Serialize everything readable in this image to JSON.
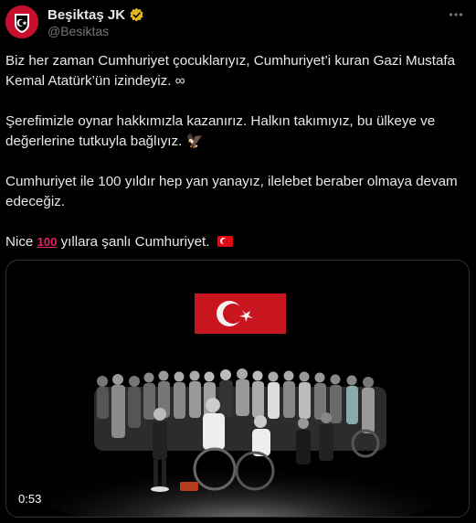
{
  "tweet": {
    "display_name": "Beşiktaş JK",
    "handle": "@Besiktas",
    "paragraphs": {
      "p1": "Biz her zaman Cumhuriyet çocuklarıyız, Cumhuriyet’i kuran Gazi Mustafa Kemal Atatürk’ün izindeyiz. ∞",
      "p2": "Şerefimizle oynar hakkımızla kazanırız. Halkın takımıyız, bu ülkeye ve değerlerine tutkuyla bağlıyız.",
      "p3": "Cumhuriyet ile 100 yıldır hep yan yanayız, ilelebet beraber olmaya devam edeceğiz.",
      "p4_before": "Nice",
      "p4_emoji": "100",
      "p4_after": "yıllara şanlı Cumhuriyet."
    },
    "eagle_emoji": "🦅",
    "flag_emoji": "turkey-flag-icon"
  },
  "media": {
    "type": "video",
    "duration": "0:53"
  },
  "colors": {
    "background": "#000000",
    "text": "#e7e9ea",
    "secondary": "#71767b",
    "verified_gold": "#e2b719",
    "brand_red": "#c8102e"
  }
}
